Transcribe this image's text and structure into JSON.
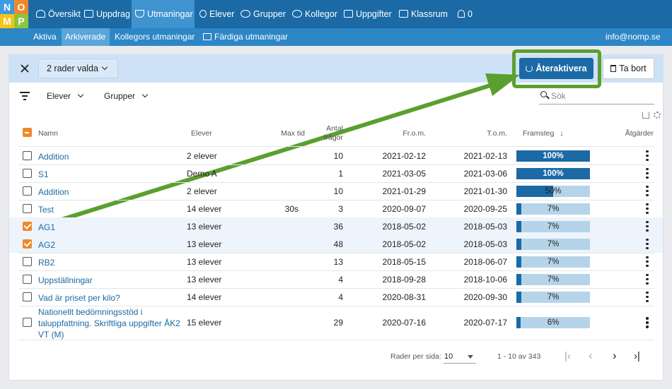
{
  "logo": {
    "letters": [
      "N",
      "O",
      "M",
      "P"
    ],
    "colors": [
      "#3d9be0",
      "#f0882b",
      "#f5c518",
      "#8cc63f"
    ]
  },
  "nav": {
    "items": [
      {
        "label": "Översikt",
        "icon": "dashboard-icon"
      },
      {
        "label": "Uppdrag",
        "icon": "book-icon"
      },
      {
        "label": "Utmaningar",
        "icon": "trophy-icon"
      },
      {
        "label": "Elever",
        "icon": "user-icon"
      },
      {
        "label": "Grupper",
        "icon": "users-icon"
      },
      {
        "label": "Kollegor",
        "icon": "user-group-icon"
      },
      {
        "label": "Uppgifter",
        "icon": "grid-icon"
      },
      {
        "label": "Klassrum",
        "icon": "classroom-icon"
      },
      {
        "label": "0",
        "icon": "bell-icon"
      }
    ],
    "active_index": 2
  },
  "subnav": {
    "items": [
      "Aktiva",
      "Arkiverade",
      "Kollegors utmaningar",
      "Färdiga utmaningar"
    ],
    "active_index": 1,
    "user_email": "info@nomp.se"
  },
  "selection": {
    "label": "2 rader valda",
    "reactivate_label": "Återaktivera",
    "delete_label": "Ta bort"
  },
  "filters": {
    "students_label": "Elever",
    "groups_label": "Grupper",
    "search_placeholder": "Sök"
  },
  "table": {
    "columns": {
      "name": "Namn",
      "students": "Elever",
      "max_time": "Max tid",
      "count_line1": "Antal",
      "count_line2": "frågor",
      "from": "Fr.o.m.",
      "to": "T.o.m.",
      "progress": "Framsteg",
      "actions": "Åtgärder"
    },
    "rows": [
      {
        "name": [
          "Addition"
        ],
        "students": "2 elever",
        "max_time": "",
        "count": "10",
        "from": "2021-02-12",
        "to": "2021-02-13",
        "progress": 1.0,
        "progress_label": "100%",
        "selected": false
      },
      {
        "name": [
          "S1"
        ],
        "students": "Demo A",
        "max_time": "",
        "count": "1",
        "from": "2021-03-05",
        "to": "2021-03-06",
        "progress": 1.0,
        "progress_label": "100%",
        "selected": false
      },
      {
        "name": [
          "Addition"
        ],
        "students": "2 elever",
        "max_time": "",
        "count": "10",
        "from": "2021-01-29",
        "to": "2021-01-30",
        "progress": 0.5,
        "progress_label": "50%",
        "selected": false
      },
      {
        "name": [
          "Test"
        ],
        "students": "14 elever",
        "max_time": "30s",
        "count": "3",
        "from": "2020-09-07",
        "to": "2020-09-25",
        "progress": 0.07,
        "progress_label": "7%",
        "selected": false
      },
      {
        "name": [
          "AG1"
        ],
        "students": "13 elever",
        "max_time": "",
        "count": "36",
        "from": "2018-05-02",
        "to": "2018-05-03",
        "progress": 0.07,
        "progress_label": "7%",
        "selected": true
      },
      {
        "name": [
          "AG2"
        ],
        "students": "13 elever",
        "max_time": "",
        "count": "48",
        "from": "2018-05-02",
        "to": "2018-05-03",
        "progress": 0.07,
        "progress_label": "7%",
        "selected": true
      },
      {
        "name": [
          "RB2"
        ],
        "students": "13 elever",
        "max_time": "",
        "count": "13",
        "from": "2018-05-15",
        "to": "2018-06-07",
        "progress": 0.07,
        "progress_label": "7%",
        "selected": false
      },
      {
        "name": [
          "Uppställningar"
        ],
        "students": "13 elever",
        "max_time": "",
        "count": "4",
        "from": "2018-09-28",
        "to": "2018-10-06",
        "progress": 0.07,
        "progress_label": "7%",
        "selected": false
      },
      {
        "name": [
          "Vad är priset per kilo?"
        ],
        "students": "14 elever",
        "max_time": "",
        "count": "4",
        "from": "2020-08-31",
        "to": "2020-09-30",
        "progress": 0.07,
        "progress_label": "7%",
        "selected": false
      },
      {
        "name": [
          "Nationellt bedömningsstöd i",
          "taluppfattning. Skriftliga uppgifter ÅK2",
          "VT (M)"
        ],
        "students": "15 elever",
        "max_time": "",
        "count": "29",
        "from": "2020-07-16",
        "to": "2020-07-17",
        "progress": 0.06,
        "progress_label": "6%",
        "selected": false
      }
    ]
  },
  "pagination": {
    "rows_per_page_label": "Rader per sida:",
    "rows_per_page": "10",
    "range": "1 - 10 av 343"
  },
  "colors": {
    "primary": "#1b6aa5",
    "selected_row": "#edf4fb",
    "checkbox_on": "#f0882b",
    "highlight": "#5b9f2f",
    "progress_track": "#b6d4e9"
  }
}
